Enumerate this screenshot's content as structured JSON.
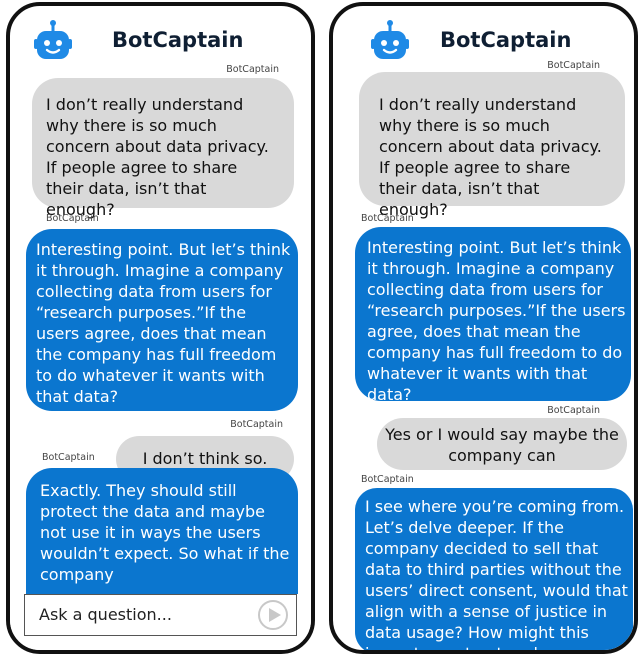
{
  "app": {
    "title": "BotCaptain"
  },
  "left_phone": {
    "messages": [
      {
        "sender": "BotCaptain",
        "role": "user",
        "text": "I don’t really understand why there is so much concern about data privacy. If people agree to share their data, isn’t that enough?"
      },
      {
        "sender": "BotCaptain",
        "role": "bot",
        "text": "Interesting point. But let’s think it through. Imagine a company collecting data from users for “research purposes.”If the users agree, does that mean the company has full freedom to do whatever it wants with that data?"
      },
      {
        "sender": "BotCaptain",
        "role": "user",
        "text": "I don’t think so."
      },
      {
        "sender": "BotCaptain",
        "role": "bot",
        "text": "Exactly. They should still protect the data and maybe not use it in ways the users wouldn’t expect. So what if the company"
      }
    ],
    "composer": {
      "placeholder": "Ask a question..."
    }
  },
  "right_phone": {
    "messages": [
      {
        "sender": "BotCaptain",
        "role": "user",
        "text": "I don’t really understand why there is so much concern about data privacy. If people agree to share their data, isn’t that enough?"
      },
      {
        "sender": "BotCaptain",
        "role": "bot",
        "text": "Interesting point. But let’s think it through. Imagine a company collecting data from users for “research purposes.”If the users agree, does that mean the company has full freedom to do whatever it wants with that data?"
      },
      {
        "sender": "BotCaptain",
        "role": "user",
        "text": "Yes or I would say maybe the company can"
      },
      {
        "sender": "BotCaptain",
        "role": "bot",
        "text": "I see where you’re coming from. Let’s delve deeper. If the company decided to sell that data to third parties without the users’ direct consent, would that align with a sense of justice in data usage? How might this impact user trust and expectations?"
      }
    ]
  },
  "colors": {
    "bot_bubble": "#0b76cf",
    "user_bubble": "#d9d9d9",
    "frame": "#111111"
  },
  "icons": {
    "logo": "robot-icon",
    "send": "send-icon"
  }
}
